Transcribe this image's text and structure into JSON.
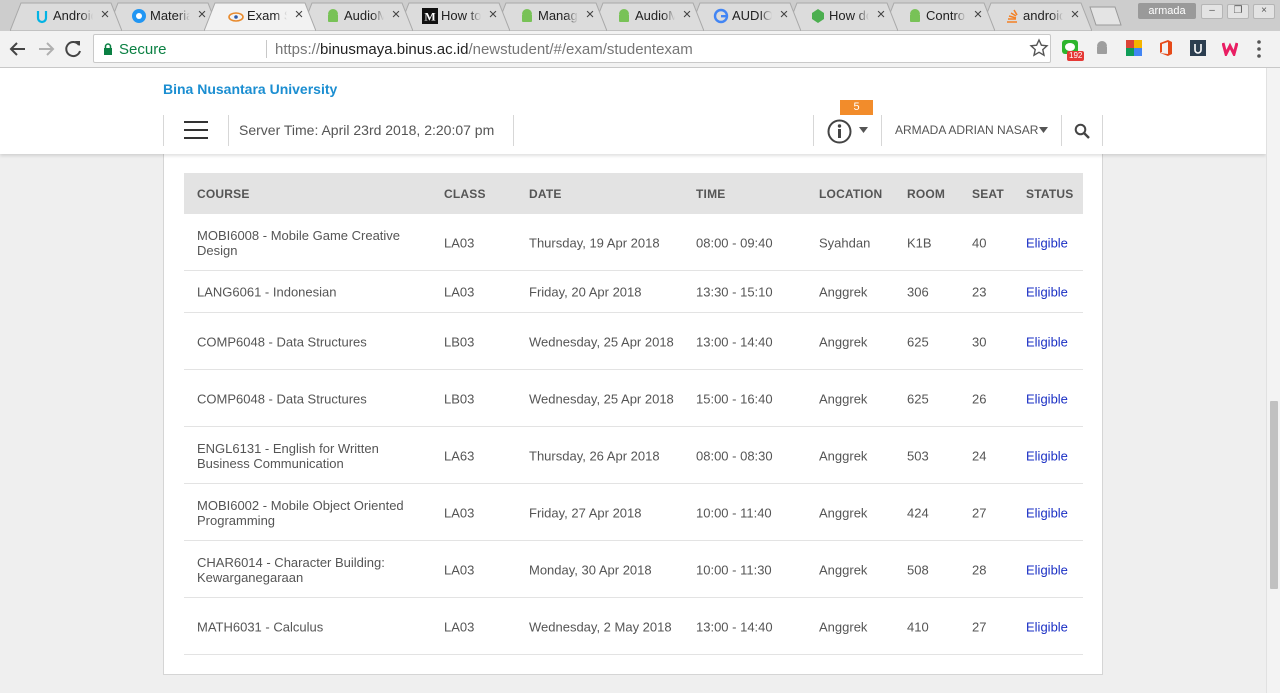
{
  "browser": {
    "tabs": [
      {
        "title": "Android",
        "icon": "udacity-icon",
        "active": false
      },
      {
        "title": "Material",
        "icon": "material-icon",
        "active": false
      },
      {
        "title": "Exam Schedule",
        "icon": "binus-icon",
        "active": true
      },
      {
        "title": "AudioManager",
        "icon": "android-icon",
        "active": false
      },
      {
        "title": "How to",
        "icon": "medium-icon",
        "active": false
      },
      {
        "title": "Manage",
        "icon": "android-icon",
        "active": false
      },
      {
        "title": "AudioManager",
        "icon": "android-icon",
        "active": false
      },
      {
        "title": "AUDIO",
        "icon": "google-icon",
        "active": false
      },
      {
        "title": "How do",
        "icon": "gitbook-icon",
        "active": false
      },
      {
        "title": "Controls",
        "icon": "android-icon",
        "active": false
      },
      {
        "title": "android",
        "icon": "stackoverflow-icon",
        "active": false
      }
    ],
    "profile_name": "armada",
    "secure_label": "Secure",
    "url_scheme": "https://",
    "url_host": "binusmaya.binus.ac.id",
    "url_path": "/newstudent/#/exam/studentexam",
    "ext_badge": "192",
    "colors": {
      "secure": "#0b8043",
      "tabstrip": "#cdcdcd"
    }
  },
  "header": {
    "brand": "Bina Nusantara University",
    "server_time": "Server Time: April 23rd 2018, 2:20:07 pm",
    "notification_count": "5",
    "user_name": "ARMADA ADRIAN NASAR",
    "colors": {
      "brand": "#1b8ed1",
      "badge": "#f28c2b",
      "status_link": "#1a2fc4"
    }
  },
  "table": {
    "columns": {
      "course": "COURSE",
      "class": "CLASS",
      "date": "DATE",
      "time": "TIME",
      "location": "LOCATION",
      "room": "ROOM",
      "seat": "SEAT",
      "status": "STATUS"
    },
    "rows": [
      {
        "course": "MOBI6008 - Mobile Game Creative Design",
        "class": "LA03",
        "date": "Thursday, 19 Apr 2018",
        "time": "08:00 - 09:40",
        "location": "Syahdan",
        "room": "K1B",
        "seat": "40",
        "status": "Eligible"
      },
      {
        "course": "LANG6061 - Indonesian",
        "class": "LA03",
        "date": "Friday, 20 Apr 2018",
        "time": "13:30 - 15:10",
        "location": "Anggrek",
        "room": "306",
        "seat": "23",
        "status": "Eligible"
      },
      {
        "course": "COMP6048 - Data Structures",
        "class": "LB03",
        "date": "Wednesday, 25 Apr 2018",
        "time": "13:00 - 14:40",
        "location": "Anggrek",
        "room": "625",
        "seat": "30",
        "status": "Eligible"
      },
      {
        "course": "COMP6048 - Data Structures",
        "class": "LB03",
        "date": "Wednesday, 25 Apr 2018",
        "time": "15:00 - 16:40",
        "location": "Anggrek",
        "room": "625",
        "seat": "26",
        "status": "Eligible"
      },
      {
        "course": "ENGL6131 - English for Written Business Communication",
        "class": "LA63",
        "date": "Thursday, 26 Apr 2018",
        "time": "08:00 - 08:30",
        "location": "Anggrek",
        "room": "503",
        "seat": "24",
        "status": "Eligible"
      },
      {
        "course": "MOBI6002 - Mobile Object Oriented Programming",
        "class": "LA03",
        "date": "Friday, 27 Apr 2018",
        "time": "10:00 - 11:40",
        "location": "Anggrek",
        "room": "424",
        "seat": "27",
        "status": "Eligible"
      },
      {
        "course": "CHAR6014 - Character Building: Kewarganegaraan",
        "class": "LA03",
        "date": "Monday, 30 Apr 2018",
        "time": "10:00 - 11:30",
        "location": "Anggrek",
        "room": "508",
        "seat": "28",
        "status": "Eligible"
      },
      {
        "course": "MATH6031 - Calculus",
        "class": "LA03",
        "date": "Wednesday, 2 May 2018",
        "time": "13:00 - 14:40",
        "location": "Anggrek",
        "room": "410",
        "seat": "27",
        "status": "Eligible"
      }
    ]
  }
}
